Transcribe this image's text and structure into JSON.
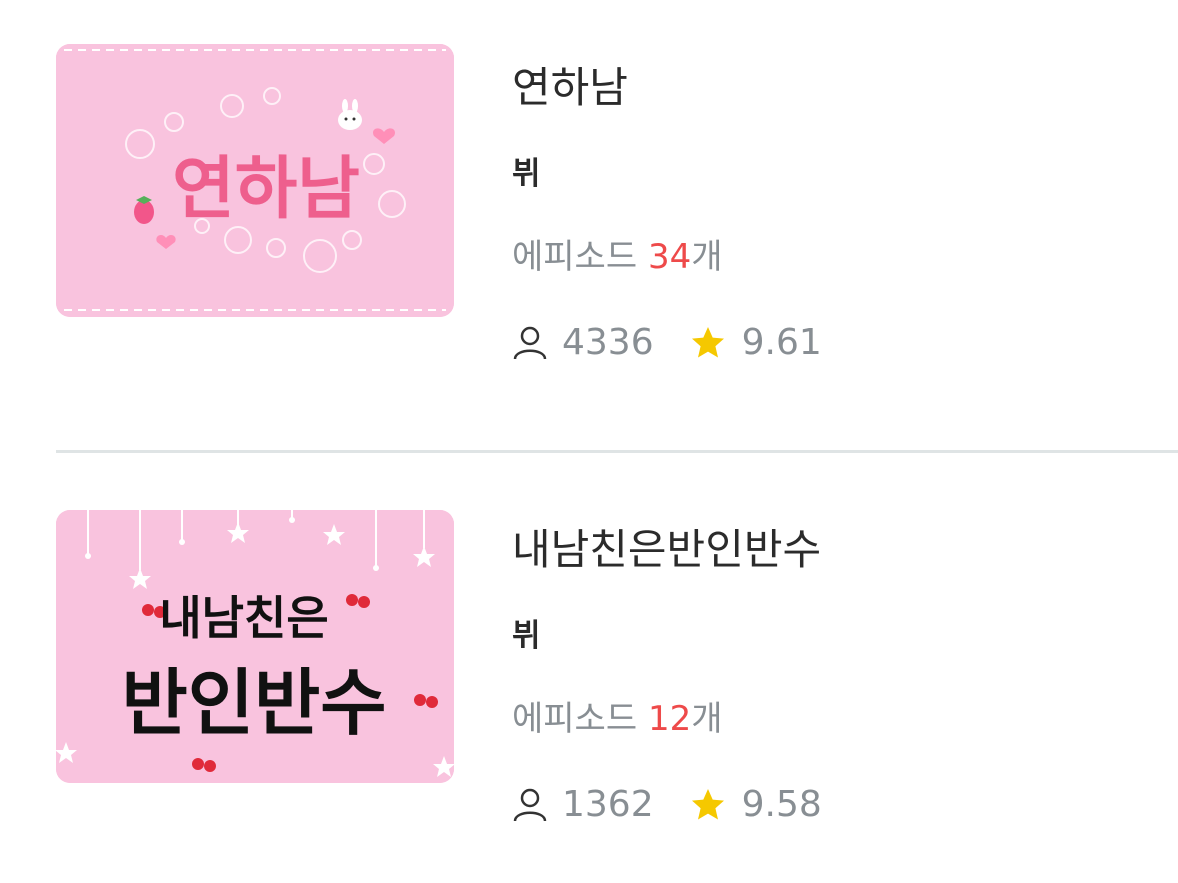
{
  "list": [
    {
      "title": "연하남",
      "author": "뷔",
      "episode_prefix": "에피소드 ",
      "episode_count": "34",
      "episode_suffix": "개",
      "views": "4336",
      "rating": "9.61",
      "thumb_text": "연하남",
      "thumb_bg": "#f9c3de",
      "thumb_text_color": "#ee5f8d"
    },
    {
      "title": "내남친은반인반수",
      "author": "뷔",
      "episode_prefix": "에피소드 ",
      "episode_count": "12",
      "episode_suffix": "개",
      "views": "1362",
      "rating": "9.58",
      "thumb_text_small": "내남친은",
      "thumb_text_large": "반인반수",
      "thumb_bg": "#f9c3de",
      "thumb_text_color": "#111111"
    }
  ],
  "colors": {
    "title": "#2b2b2b",
    "muted": "#888e93",
    "accent_red": "#ee4a4a",
    "star": "#f5c800",
    "divider": "#dfe4e5"
  },
  "icons": {
    "views": "user-icon",
    "rating": "star-icon"
  }
}
